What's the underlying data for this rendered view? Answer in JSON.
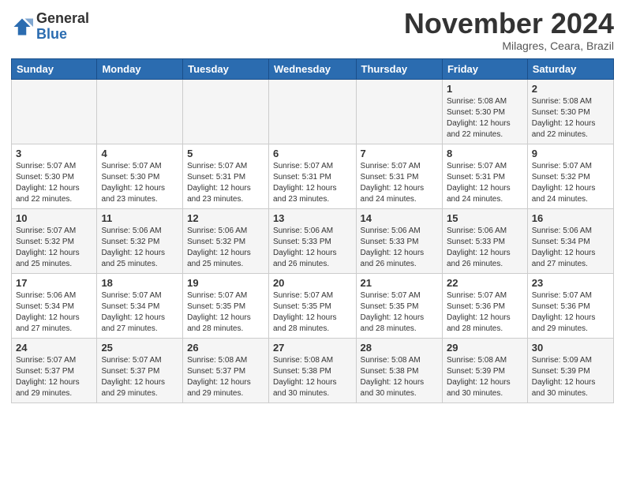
{
  "logo": {
    "general": "General",
    "blue": "Blue"
  },
  "header": {
    "month": "November 2024",
    "location": "Milagres, Ceara, Brazil"
  },
  "days_of_week": [
    "Sunday",
    "Monday",
    "Tuesday",
    "Wednesday",
    "Thursday",
    "Friday",
    "Saturday"
  ],
  "weeks": [
    [
      {
        "day": "",
        "info": ""
      },
      {
        "day": "",
        "info": ""
      },
      {
        "day": "",
        "info": ""
      },
      {
        "day": "",
        "info": ""
      },
      {
        "day": "",
        "info": ""
      },
      {
        "day": "1",
        "info": "Sunrise: 5:08 AM\nSunset: 5:30 PM\nDaylight: 12 hours and 22 minutes."
      },
      {
        "day": "2",
        "info": "Sunrise: 5:08 AM\nSunset: 5:30 PM\nDaylight: 12 hours and 22 minutes."
      }
    ],
    [
      {
        "day": "3",
        "info": "Sunrise: 5:07 AM\nSunset: 5:30 PM\nDaylight: 12 hours and 22 minutes."
      },
      {
        "day": "4",
        "info": "Sunrise: 5:07 AM\nSunset: 5:30 PM\nDaylight: 12 hours and 23 minutes."
      },
      {
        "day": "5",
        "info": "Sunrise: 5:07 AM\nSunset: 5:31 PM\nDaylight: 12 hours and 23 minutes."
      },
      {
        "day": "6",
        "info": "Sunrise: 5:07 AM\nSunset: 5:31 PM\nDaylight: 12 hours and 23 minutes."
      },
      {
        "day": "7",
        "info": "Sunrise: 5:07 AM\nSunset: 5:31 PM\nDaylight: 12 hours and 24 minutes."
      },
      {
        "day": "8",
        "info": "Sunrise: 5:07 AM\nSunset: 5:31 PM\nDaylight: 12 hours and 24 minutes."
      },
      {
        "day": "9",
        "info": "Sunrise: 5:07 AM\nSunset: 5:32 PM\nDaylight: 12 hours and 24 minutes."
      }
    ],
    [
      {
        "day": "10",
        "info": "Sunrise: 5:07 AM\nSunset: 5:32 PM\nDaylight: 12 hours and 25 minutes."
      },
      {
        "day": "11",
        "info": "Sunrise: 5:06 AM\nSunset: 5:32 PM\nDaylight: 12 hours and 25 minutes."
      },
      {
        "day": "12",
        "info": "Sunrise: 5:06 AM\nSunset: 5:32 PM\nDaylight: 12 hours and 25 minutes."
      },
      {
        "day": "13",
        "info": "Sunrise: 5:06 AM\nSunset: 5:33 PM\nDaylight: 12 hours and 26 minutes."
      },
      {
        "day": "14",
        "info": "Sunrise: 5:06 AM\nSunset: 5:33 PM\nDaylight: 12 hours and 26 minutes."
      },
      {
        "day": "15",
        "info": "Sunrise: 5:06 AM\nSunset: 5:33 PM\nDaylight: 12 hours and 26 minutes."
      },
      {
        "day": "16",
        "info": "Sunrise: 5:06 AM\nSunset: 5:34 PM\nDaylight: 12 hours and 27 minutes."
      }
    ],
    [
      {
        "day": "17",
        "info": "Sunrise: 5:06 AM\nSunset: 5:34 PM\nDaylight: 12 hours and 27 minutes."
      },
      {
        "day": "18",
        "info": "Sunrise: 5:07 AM\nSunset: 5:34 PM\nDaylight: 12 hours and 27 minutes."
      },
      {
        "day": "19",
        "info": "Sunrise: 5:07 AM\nSunset: 5:35 PM\nDaylight: 12 hours and 28 minutes."
      },
      {
        "day": "20",
        "info": "Sunrise: 5:07 AM\nSunset: 5:35 PM\nDaylight: 12 hours and 28 minutes."
      },
      {
        "day": "21",
        "info": "Sunrise: 5:07 AM\nSunset: 5:35 PM\nDaylight: 12 hours and 28 minutes."
      },
      {
        "day": "22",
        "info": "Sunrise: 5:07 AM\nSunset: 5:36 PM\nDaylight: 12 hours and 28 minutes."
      },
      {
        "day": "23",
        "info": "Sunrise: 5:07 AM\nSunset: 5:36 PM\nDaylight: 12 hours and 29 minutes."
      }
    ],
    [
      {
        "day": "24",
        "info": "Sunrise: 5:07 AM\nSunset: 5:37 PM\nDaylight: 12 hours and 29 minutes."
      },
      {
        "day": "25",
        "info": "Sunrise: 5:07 AM\nSunset: 5:37 PM\nDaylight: 12 hours and 29 minutes."
      },
      {
        "day": "26",
        "info": "Sunrise: 5:08 AM\nSunset: 5:37 PM\nDaylight: 12 hours and 29 minutes."
      },
      {
        "day": "27",
        "info": "Sunrise: 5:08 AM\nSunset: 5:38 PM\nDaylight: 12 hours and 30 minutes."
      },
      {
        "day": "28",
        "info": "Sunrise: 5:08 AM\nSunset: 5:38 PM\nDaylight: 12 hours and 30 minutes."
      },
      {
        "day": "29",
        "info": "Sunrise: 5:08 AM\nSunset: 5:39 PM\nDaylight: 12 hours and 30 minutes."
      },
      {
        "day": "30",
        "info": "Sunrise: 5:09 AM\nSunset: 5:39 PM\nDaylight: 12 hours and 30 minutes."
      }
    ]
  ]
}
